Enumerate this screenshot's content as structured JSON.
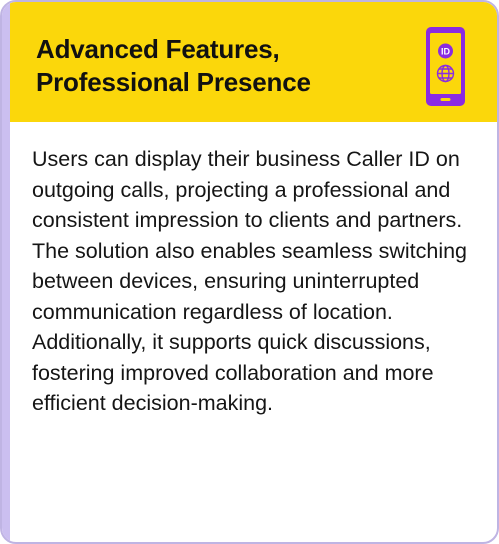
{
  "card": {
    "title_line1": "Advanced Features,",
    "title_line2": "Professional Presence",
    "icon": "phone-caller-id-icon",
    "icon_badge": "ID",
    "body": "Users can display their business Caller ID on outgoing calls, projecting a professional and consistent impression to clients and partners. The solution also enables seamless switching between devices, ensuring uninterrupted communication regardless of location. Additionally, it supports quick discussions, fostering improved collaboration and more efficient decision-making."
  },
  "colors": {
    "header_background": "#fbd70b",
    "accent_purple": "#8a2be2",
    "border_lavender": "#bfb4e3",
    "text": "#151515"
  }
}
